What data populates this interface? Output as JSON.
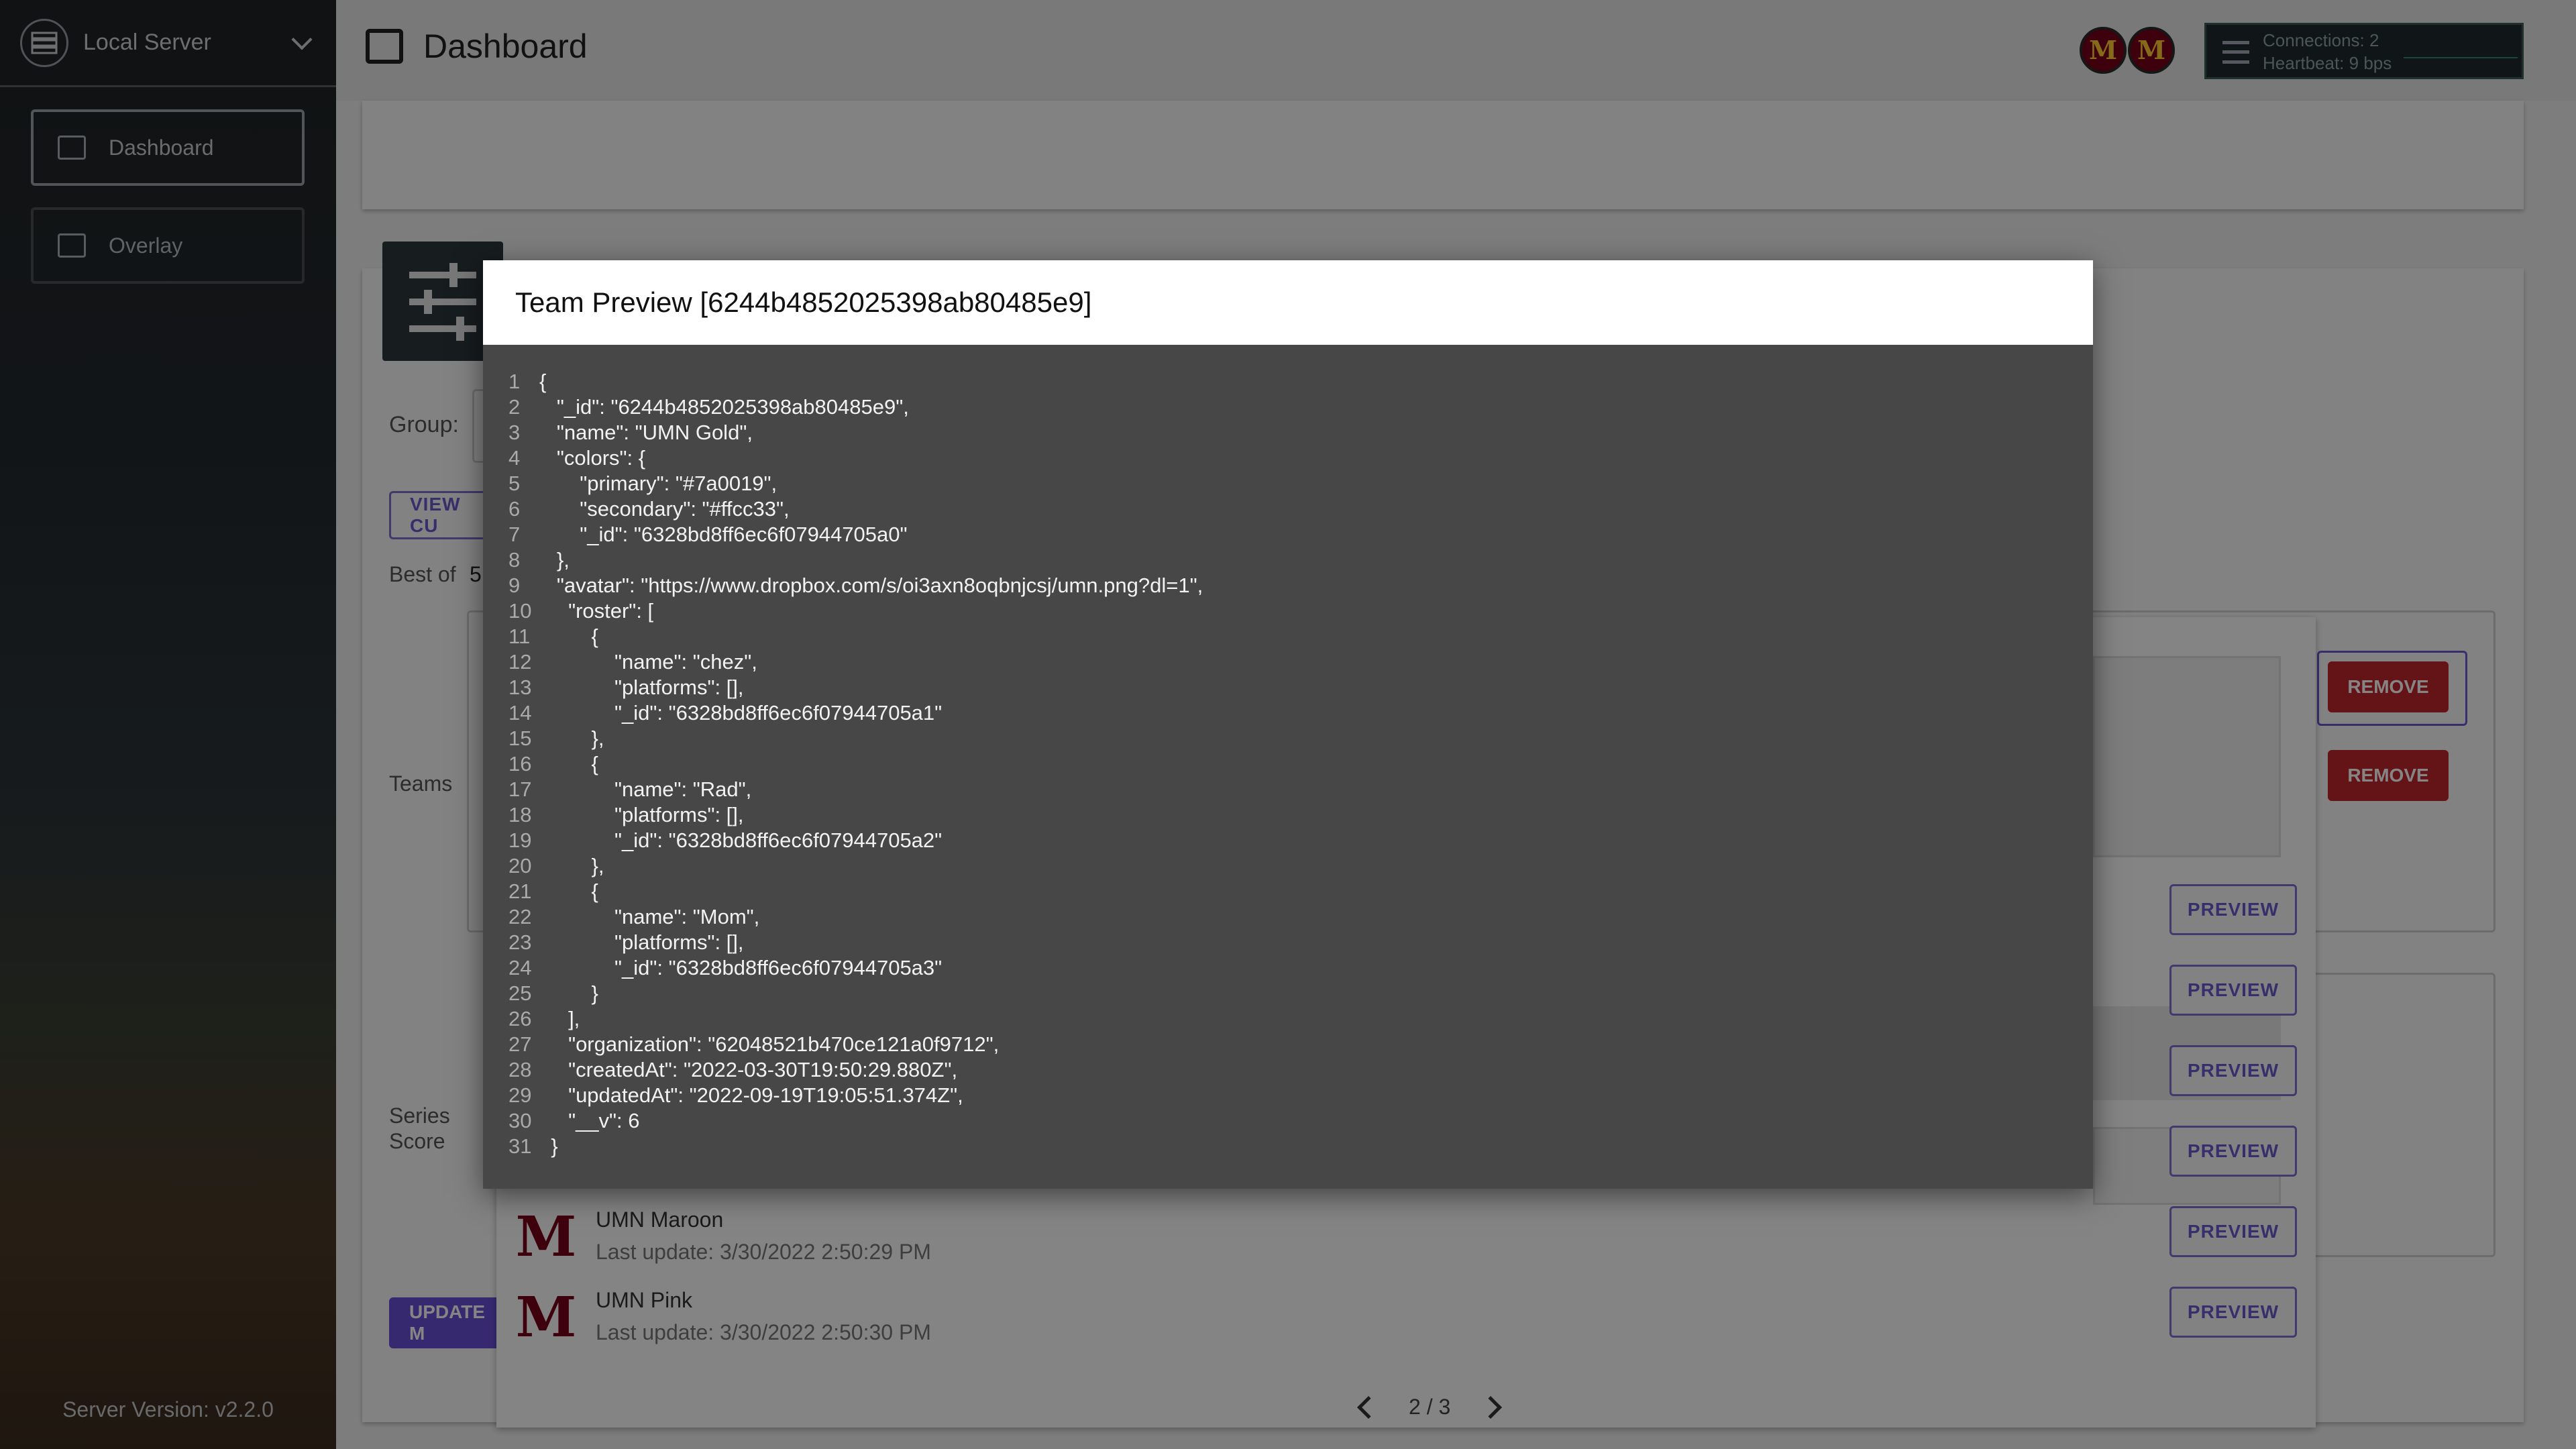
{
  "sidebar": {
    "server_name": "Local Server",
    "items": [
      {
        "label": "Dashboard",
        "icon": "dashboard-icon"
      },
      {
        "label": "Overlay",
        "icon": "monitor-icon"
      }
    ],
    "version": "Server Version: v2.2.0"
  },
  "header": {
    "title": "Dashboard",
    "connections": "Connections: 2",
    "heartbeat": "Heartbeat: 9 bps",
    "avatar_glyph": "M"
  },
  "main": {
    "group_label": "Group:",
    "view_button": "VIEW CU",
    "best_of_label": "Best of",
    "best_of_value": "5",
    "teams_label": "Teams",
    "series_score_label": "Series Score",
    "update_button": "UPDATE M",
    "remove_label": "REMOVE",
    "preview_label": "PREVIEW"
  },
  "team_list": {
    "rows": [
      {
        "name": "UMN Maroon",
        "updated": "Last update: 3/30/2022 2:50:29 PM"
      },
      {
        "name": "UMN Pink",
        "updated": "Last update: 3/30/2022 2:50:30 PM"
      }
    ],
    "page": "2 / 3"
  },
  "modal": {
    "title": "Team Preview [6244b4852025398ab80485e9]",
    "lines": [
      "{",
      "   \"_id\": \"6244b4852025398ab80485e9\",",
      "   \"name\": \"UMN Gold\",",
      "   \"colors\": {",
      "       \"primary\": \"#7a0019\",",
      "       \"secondary\": \"#ffcc33\",",
      "       \"_id\": \"6328bd8ff6ec6f07944705a0\"",
      "   },",
      "   \"avatar\": \"https://www.dropbox.com/s/oi3axn8oqbnjcsj/umn.png?dl=1\",",
      "     \"roster\": [",
      "         {",
      "             \"name\": \"chez\",",
      "             \"platforms\": [],",
      "             \"_id\": \"6328bd8ff6ec6f07944705a1\"",
      "         },",
      "         {",
      "             \"name\": \"Rad\",",
      "             \"platforms\": [],",
      "             \"_id\": \"6328bd8ff6ec6f07944705a2\"",
      "         },",
      "         {",
      "             \"name\": \"Mom\",",
      "             \"platforms\": [],",
      "             \"_id\": \"6328bd8ff6ec6f07944705a3\"",
      "         }",
      "     ],",
      "     \"organization\": \"62048521b470ce121a0f9712\",",
      "     \"createdAt\": \"2022-03-30T19:50:29.880Z\",",
      "     \"updatedAt\": \"2022-09-19T19:05:51.374Z\",",
      "     \"__v\": 6",
      "  }"
    ]
  },
  "colors": {
    "accent": "#6a4fd6",
    "danger": "#c0262d",
    "maroon": "#7a0019",
    "gold": "#ffcc33"
  }
}
